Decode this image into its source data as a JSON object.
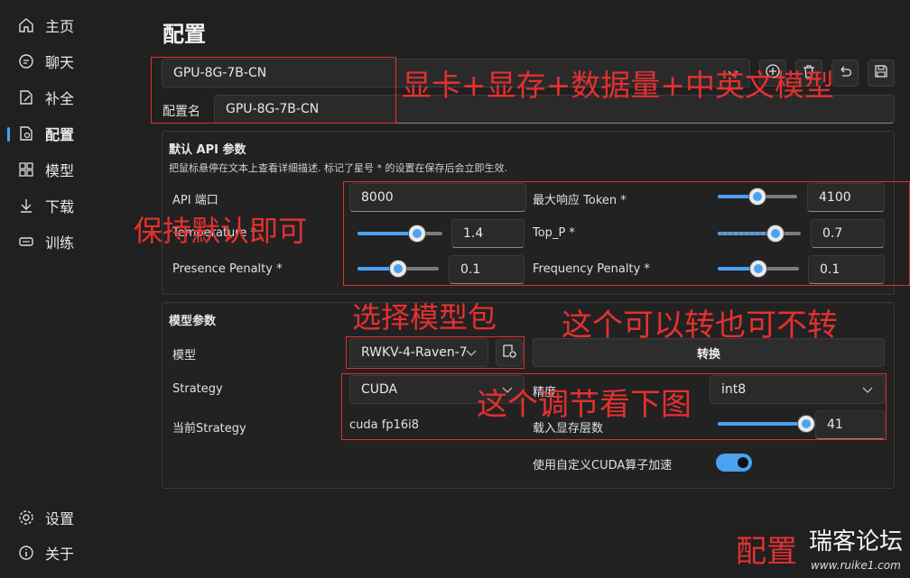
{
  "sidebar": {
    "items": [
      {
        "label": "主页",
        "icon": "home-icon"
      },
      {
        "label": "聊天",
        "icon": "chat-icon"
      },
      {
        "label": "补全",
        "icon": "pencil-icon"
      },
      {
        "label": "配置",
        "icon": "config-file-icon",
        "active": true
      },
      {
        "label": "模型",
        "icon": "grid-icon"
      },
      {
        "label": "下载",
        "icon": "download-icon"
      },
      {
        "label": "训练",
        "icon": "train-icon"
      }
    ],
    "bottom": [
      {
        "label": "设置",
        "icon": "gear-icon"
      },
      {
        "label": "关于",
        "icon": "info-icon"
      }
    ]
  },
  "page": {
    "title": "配置"
  },
  "config": {
    "selected": "GPU-8G-7B-CN",
    "name_label": "配置名",
    "name_value": "GPU-8G-7B-CN"
  },
  "api_panel": {
    "title": "默认 API 参数",
    "hint": "把鼠标悬停在文本上查看详细描述. 标记了星号 * 的设置在保存后会立即生效.",
    "api_port_label": "API 端口",
    "api_port_value": "8000",
    "max_token_label": "最大响应 Token *",
    "max_token_value": "4100",
    "temperature_label": "Temperature *",
    "temperature_value": "1.4",
    "top_p_label": "Top_P *",
    "top_p_value": "0.7",
    "presence_label": "Presence Penalty *",
    "presence_value": "0.1",
    "frequency_label": "Frequency Penalty *",
    "frequency_value": "0.1",
    "sliders": {
      "max_token": 0.5,
      "temperature": 0.7,
      "top_p": 0.7,
      "presence": 0.5,
      "frequency": 0.5
    }
  },
  "model_panel": {
    "title": "模型参数",
    "model_label": "模型",
    "model_value": "RWKV-4-Raven-7",
    "convert_label": "转换",
    "strategy_label": "Strategy",
    "strategy_value": "CUDA",
    "precision_label": "精度",
    "precision_value": "int8",
    "current_strategy_label": "当前Strategy",
    "current_strategy_value": "cuda fp16i8",
    "layers_label": "载入显存层数",
    "layers_value": "41",
    "layers_slider": 0.98,
    "custom_cuda_label": "使用自定义CUDA算子加速",
    "custom_cuda_on": true
  },
  "annotations": {
    "gpu": "显卡+显存+数据量+中英文模型",
    "keep_default": "保持默认即可",
    "choose_model": "选择模型包",
    "convert_note": "这个可以转也可不转",
    "adjust_note": "这个调节看下图",
    "config_note": "配置"
  },
  "watermark": {
    "text": "瑞客论坛",
    "url": "www.ruike1.com"
  },
  "colors": {
    "accent": "#4aa3f0",
    "annotation": "#e53030",
    "background": "#202020"
  }
}
